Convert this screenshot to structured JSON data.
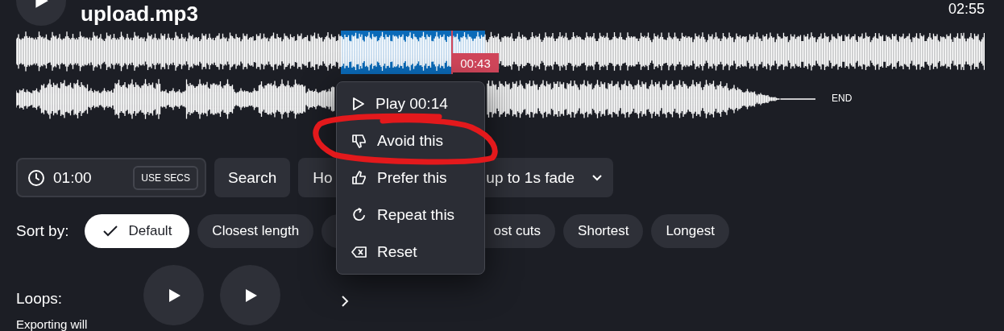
{
  "track": {
    "title": "upload.mp3",
    "duration": "02:55"
  },
  "waveform": {
    "playhead_time": "00:43",
    "end_label": "END"
  },
  "context_menu": [
    {
      "kind": "play",
      "label": "Play 00:14"
    },
    {
      "kind": "avoid",
      "label": "Avoid this"
    },
    {
      "kind": "prefer",
      "label": "Prefer this"
    },
    {
      "kind": "repeat",
      "label": "Repeat this"
    },
    {
      "kind": "reset",
      "label": "Reset"
    }
  ],
  "controls": {
    "length_value": "01:00",
    "use_secs_button": "USE SECS",
    "search_button": "Search",
    "hidden_button": "Ho",
    "fade_dropdown": "up to 1s fade"
  },
  "sort": {
    "label": "Sort by:",
    "options": [
      {
        "label": "Default",
        "selected": true
      },
      {
        "label": "Closest length",
        "selected": false
      },
      {
        "label": "ost cuts",
        "selected": false,
        "partly_hidden": true
      },
      {
        "label": "Shortest",
        "selected": false
      },
      {
        "label": "Longest",
        "selected": false
      }
    ]
  },
  "loops": {
    "label": "Loops:",
    "note": "Exporting will",
    "items": [
      {
        "kind": "play"
      },
      {
        "kind": "play"
      }
    ]
  }
}
